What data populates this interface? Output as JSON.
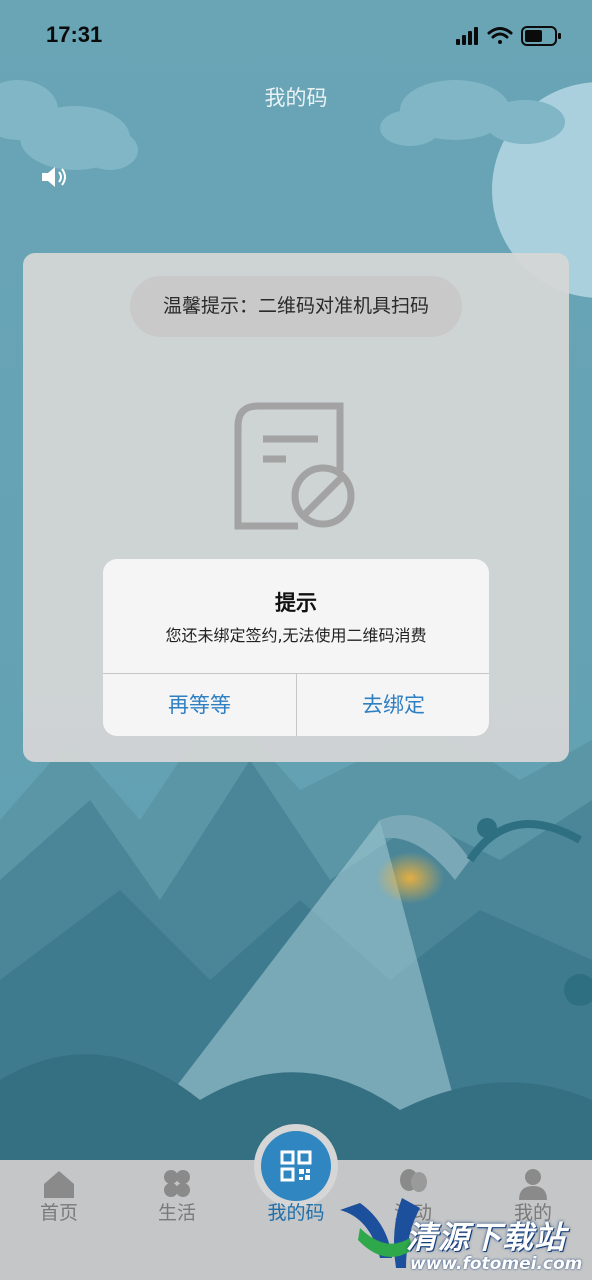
{
  "status_bar": {
    "time": "17:31",
    "wifi_icon": "wifi-icon",
    "signal_icon": "cellular-signal-icon",
    "battery_icon": "battery-icon"
  },
  "page": {
    "title": "我的码",
    "speaker_icon": "speaker-icon"
  },
  "panel": {
    "tip": "温馨提示：二维码对准机具扫码",
    "empty_icon": "document-disabled-icon"
  },
  "dialog": {
    "title": "提示",
    "message": "您还未绑定签约,无法使用二维码消费",
    "cancel_label": "再等等",
    "confirm_label": "去绑定"
  },
  "tabbar": {
    "items": [
      {
        "label": "首页",
        "icon": "home-icon"
      },
      {
        "label": "生活",
        "icon": "clover-icon"
      },
      {
        "label": "我的码",
        "icon": "qr-code-icon",
        "active": true
      },
      {
        "label": "活动",
        "icon": "balloon-icon"
      },
      {
        "label": "我的",
        "icon": "user-icon"
      }
    ]
  },
  "watermark": {
    "text": "清源下载站",
    "url": "www.fotomei.com"
  },
  "colors": {
    "sky": "#6aa7b7",
    "accent_blue": "#2f86c0",
    "dialog_button": "#2f7fc3",
    "tabbar_bg": "#c4c6c7"
  }
}
